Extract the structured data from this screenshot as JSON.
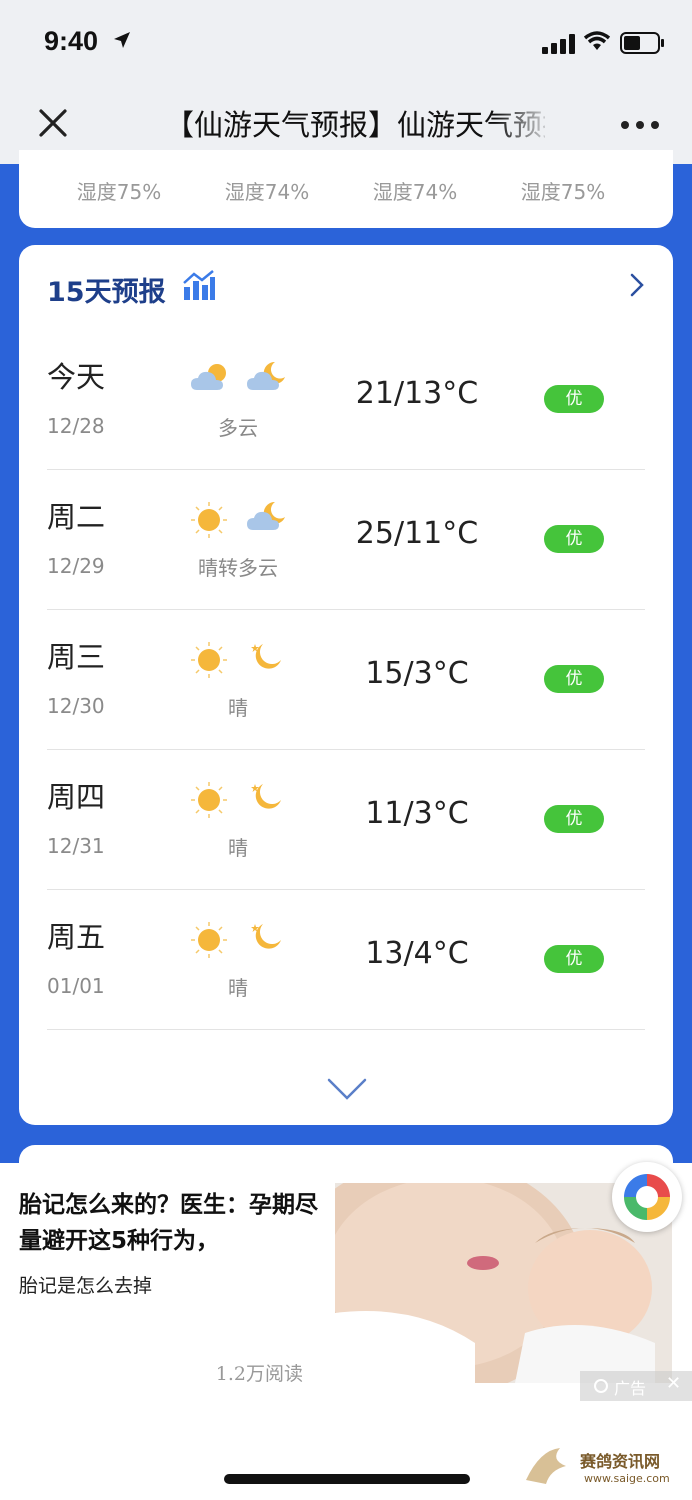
{
  "status_bar": {
    "time": "9:40"
  },
  "nav": {
    "title": "【仙游天气预报】仙游天气预报"
  },
  "humidity": [
    "湿度75%",
    "湿度74%",
    "湿度74%",
    "湿度75%"
  ],
  "forecast": {
    "title": "15天预报",
    "days": [
      {
        "day": "今天",
        "date": "12/28",
        "condition": "多云",
        "temp": "21/13°C",
        "aqi": "优",
        "day_icon": "cloud-sun-icon",
        "night_icon": "cloud-moon-icon"
      },
      {
        "day": "周二",
        "date": "12/29",
        "condition": "晴转多云",
        "temp": "25/11°C",
        "aqi": "优",
        "day_icon": "sun-icon",
        "night_icon": "cloud-moon-icon"
      },
      {
        "day": "周三",
        "date": "12/30",
        "condition": "晴",
        "temp": "15/3°C",
        "aqi": "优",
        "day_icon": "sun-icon",
        "night_icon": "moon-icon"
      },
      {
        "day": "周四",
        "date": "12/31",
        "condition": "晴",
        "temp": "11/3°C",
        "aqi": "优",
        "day_icon": "sun-icon",
        "night_icon": "moon-icon"
      },
      {
        "day": "周五",
        "date": "01/01",
        "condition": "晴",
        "temp": "13/4°C",
        "aqi": "优",
        "day_icon": "sun-icon",
        "night_icon": "moon-icon"
      }
    ]
  },
  "ad": {
    "title": "胎记怎么来的？医生：孕期尽量避开这5种行为，",
    "subtitle": "胎记是怎么去掉",
    "reads": "1.2万阅读",
    "badge": "广告"
  },
  "watermark": {
    "name": "赛鸽资讯网",
    "url": "www.saige.com"
  },
  "colors": {
    "accent_blue": "#2b63d9",
    "aqi_green": "#45c43b",
    "title_blue": "#1e3f8a"
  }
}
